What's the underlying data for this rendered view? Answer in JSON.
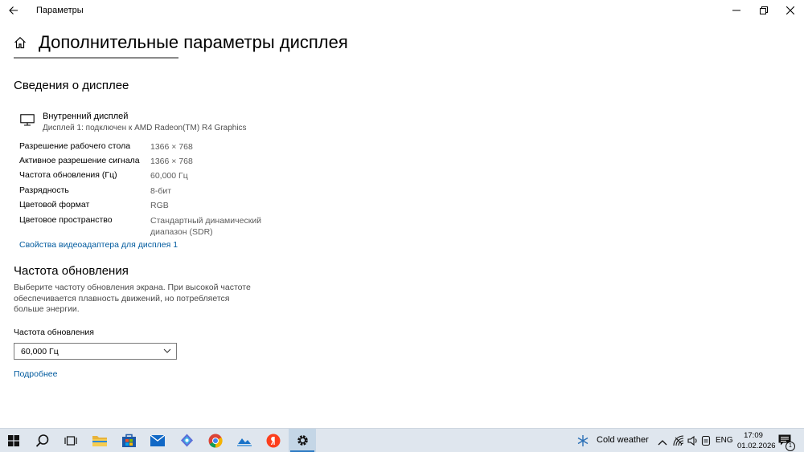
{
  "window": {
    "title": "Параметры",
    "back_icon": "arrow-left-icon",
    "controls": [
      "minimize-icon",
      "restore-icon",
      "close-icon"
    ]
  },
  "header": {
    "home_icon": "home-icon",
    "title": "Дополнительные параметры дисплея"
  },
  "display_info": {
    "section_title": "Сведения о дисплее",
    "monitor_icon": "monitor-icon",
    "display_name": "Внутренний дисплей",
    "display_subtitle": "Дисплей 1: подключен к AMD Radeon(TM) R4 Graphics",
    "rows": [
      {
        "key": "Разрешение рабочего стола",
        "value": "1366 × 768"
      },
      {
        "key": "Активное разрешение сигнала",
        "value": "1366 × 768"
      },
      {
        "key": "Частота обновления (Гц)",
        "value": "60,000 Гц"
      },
      {
        "key": "Разрядность",
        "value": "8-бит"
      },
      {
        "key": "Цветовой формат",
        "value": "RGB"
      },
      {
        "key": "Цветовое пространство",
        "value": "Стандартный динамический диапазон (SDR)"
      }
    ],
    "adapter_link": "Свойства видеоадаптера для дисплея 1"
  },
  "refresh": {
    "section_title": "Частота обновления",
    "description": "Выберите частоту обновления экрана. При высокой частоте обеспечивается плавность движений, но потребляется больше энергии.",
    "field_label": "Частота обновления",
    "selected_value": "60,000 Гц",
    "more_link": "Подробнее"
  },
  "taskbar": {
    "apps": [
      "windows-start-icon",
      "search-icon",
      "task-view-icon",
      "file-explorer-icon",
      "microsoft-store-icon",
      "mail-icon",
      "copilot-icon",
      "chrome-icon",
      "photos-icon",
      "yandex-browser-icon",
      "settings-icon"
    ],
    "weather": "Cold weather",
    "language": "ENG",
    "time": "17:09",
    "date": "01.02.2026",
    "notification_count": "1"
  },
  "colors": {
    "link": "#005a9e",
    "taskbar_bg": "#dfe6ee",
    "active_indicator": "#2d7bc4"
  }
}
